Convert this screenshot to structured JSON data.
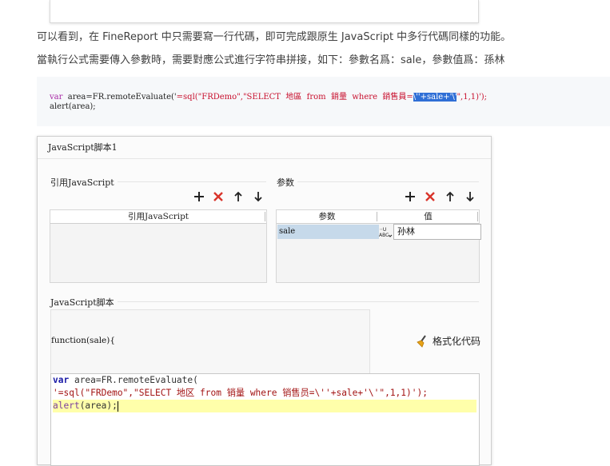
{
  "article": {
    "para1": "可以看到，在 FineReport 中只需要寫一行代碼，即可完成跟原生 JavaScript 中多行代碼同樣的功能。",
    "para2": "當執行公式需要傳入參數時，需要對應公式進行字符串拼接，如下：參數名爲：sale，參數值爲：孫林"
  },
  "code_block": {
    "line1_kw": "var",
    "line1_a": "  area=FR.remoteEvaluate('",
    "line1_b": "=sql(\"FRDemo\",\"SELECT  地區  from  銷量  where  銷售員=",
    "line1_sel": "\\''+sale+'\\'",
    "line1_c": "\",1,1)');",
    "line2": "alert(area);"
  },
  "dialog": {
    "title": "JavaScript脚本1",
    "ref_js_section": "引用JavaScript",
    "ref_js_column": "引用JavaScript",
    "params_section": "参数",
    "params_col_name": "参数",
    "params_col_value": "值",
    "param_name": "sale",
    "param_value": "孙林",
    "param_type_icon_text": "ABC",
    "script_section": "JavaScript脚本",
    "function_signature": "function(sale){",
    "format_button": "格式化代码",
    "editor": {
      "l1_kw": "var",
      "l1_rest": " area=FR.remoteEvaluate(",
      "l2": "'=sql(\"FRDemo\",\"SELECT 地区 from 销量 where 销售员=\\''+sale+'\\'\",1,1)');",
      "l3_fn": "alert",
      "l3_rest": "(area);"
    }
  },
  "colors": {
    "delete_red": "#d9342b",
    "selection_blue": "#2f6fd6",
    "param_row": "#c6d9ea",
    "current_line": "#ffffaa"
  }
}
